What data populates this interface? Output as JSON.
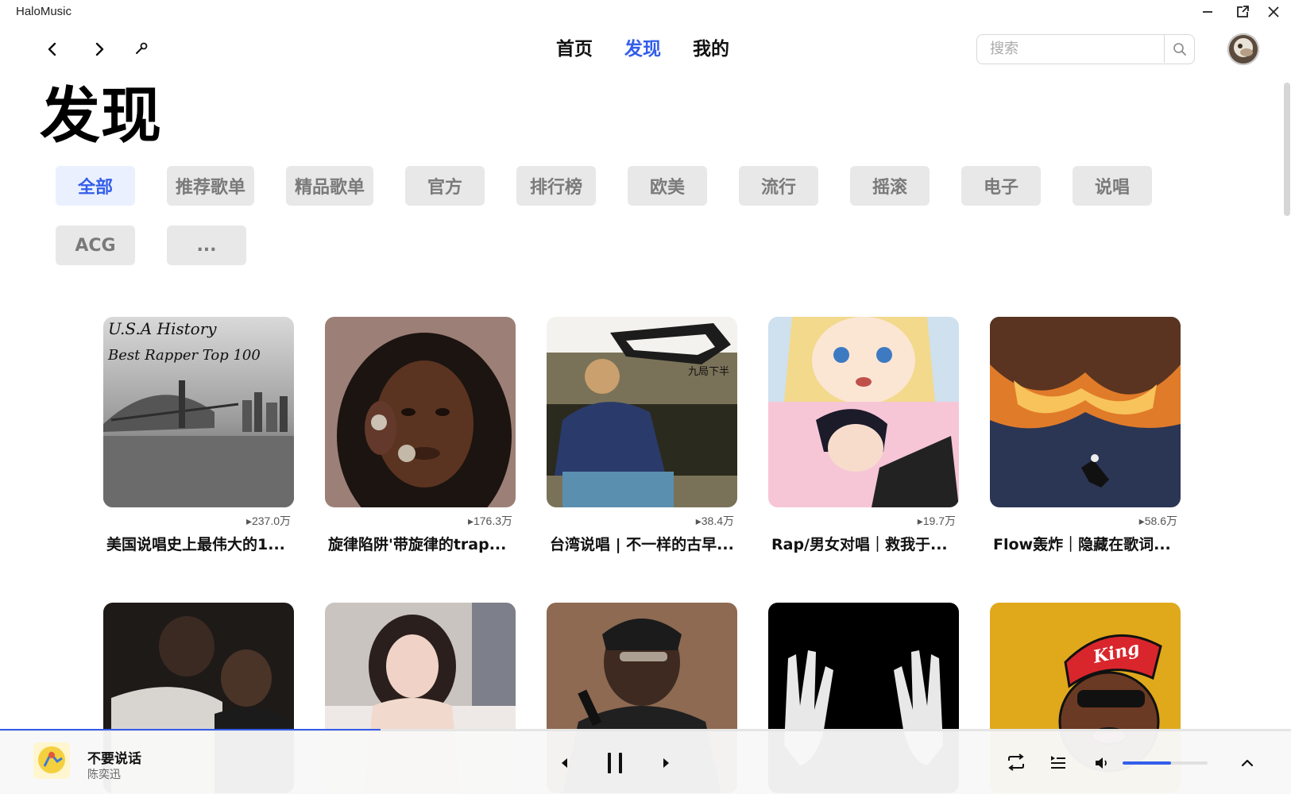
{
  "window": {
    "title": "HaloMusic",
    "minimize_icon": "minimize-icon",
    "popout_icon": "popout-icon",
    "close_icon": "close-icon"
  },
  "nav": {
    "tabs": [
      {
        "label": "首页",
        "active": false
      },
      {
        "label": "发现",
        "active": true
      },
      {
        "label": "我的",
        "active": false
      }
    ],
    "search_placeholder": "搜索"
  },
  "page_title": "发现",
  "categories": [
    {
      "label": "全部",
      "active": true
    },
    {
      "label": "推荐歌单",
      "active": false
    },
    {
      "label": "精品歌单",
      "active": false
    },
    {
      "label": "官方",
      "active": false
    },
    {
      "label": "排行榜",
      "active": false
    },
    {
      "label": "欧美",
      "active": false
    },
    {
      "label": "流行",
      "active": false
    },
    {
      "label": "摇滚",
      "active": false
    },
    {
      "label": "电子",
      "active": false
    },
    {
      "label": "说唱",
      "active": false
    },
    {
      "label": "ACG",
      "active": false
    },
    {
      "label": "...",
      "active": false
    }
  ],
  "playlists": [
    {
      "title": "美国说唱史上最伟大的1...",
      "play_count": "▸237.0万",
      "cover_text": [
        "U.S.A History",
        "Best Rapper Top 100"
      ]
    },
    {
      "title": "旋律陷阱'带旋律的trap...",
      "play_count": "▸176.3万"
    },
    {
      "title": "台湾说唱 | 不一样的古早...",
      "play_count": "▸38.4万",
      "cover_text": [
        "九局下半"
      ]
    },
    {
      "title": "Rap/男女对唱｜救我于...",
      "play_count": "▸19.7万"
    },
    {
      "title": "Flow轰炸｜隐藏在歌词...",
      "play_count": "▸58.6万"
    },
    {
      "title": "",
      "play_count": ""
    },
    {
      "title": "",
      "play_count": ""
    },
    {
      "title": "",
      "play_count": ""
    },
    {
      "title": "",
      "play_count": ""
    },
    {
      "title": "",
      "play_count": "",
      "cover_text": [
        "King"
      ]
    }
  ],
  "player": {
    "title": "不要说话",
    "artist": "陈奕迅",
    "progress": 0.295,
    "volume": 0.57,
    "accent_color": "#335eea"
  }
}
